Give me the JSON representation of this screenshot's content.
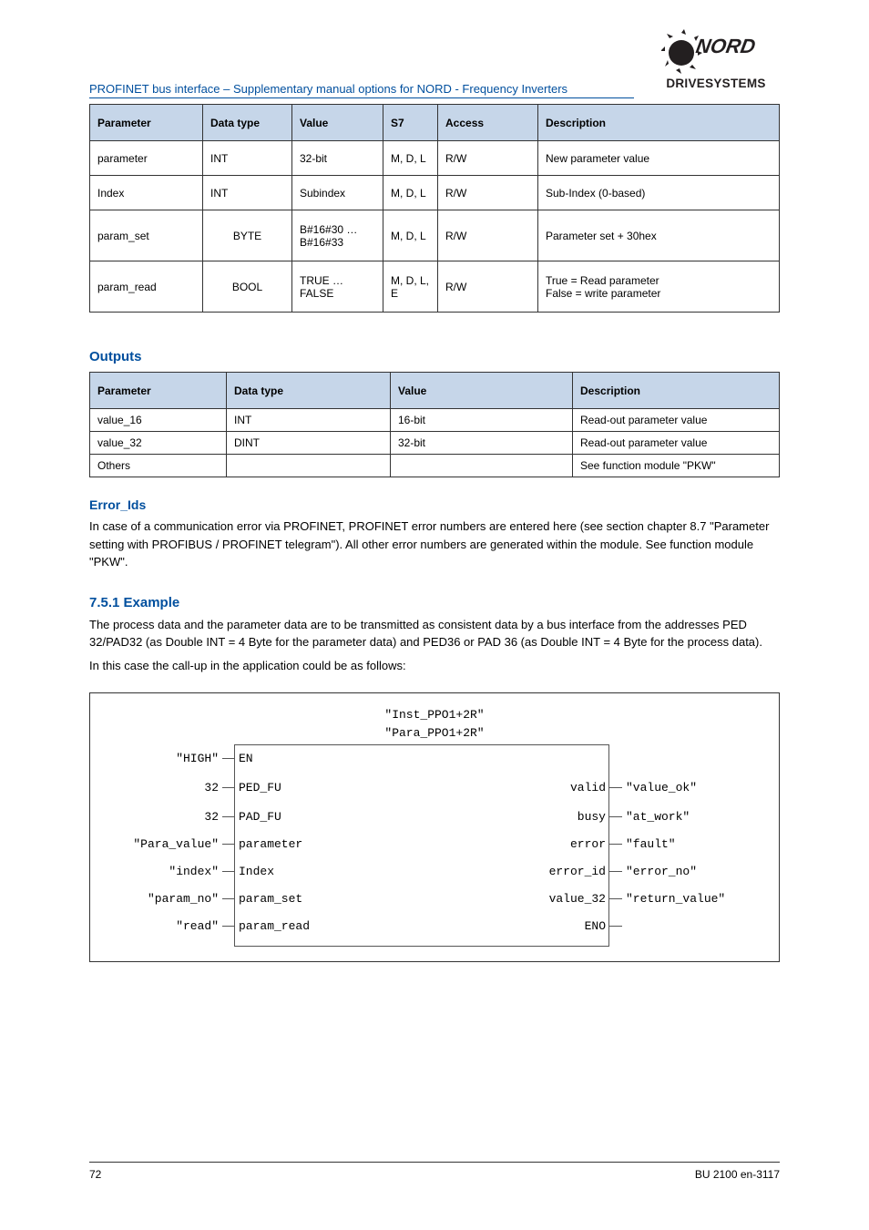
{
  "header": {
    "title": "PROFINET bus interface – Supplementary manual options for NORD - Frequency Inverters"
  },
  "logo": {
    "brand": "NORD",
    "sub": "DRIVESYSTEMS"
  },
  "table1": {
    "headers": [
      "Parameter",
      "Data type",
      "Value",
      "S7",
      "Access",
      "Description"
    ],
    "rows": [
      {
        "c0": "parameter",
        "c1": "INT",
        "c2": "32-bit",
        "c3": "M, D, L",
        "c4": "R/W",
        "c5": "New parameter value"
      },
      {
        "c0": "Index",
        "c1": "INT",
        "c2": "Subindex",
        "c3": "M, D, L",
        "c4": "R/W",
        "c5": "Sub-Index (0-based)"
      },
      {
        "c0": "param_set",
        "c1": "BYTE",
        "c2": "B#16#30 … B#16#33",
        "c3": "M, D, L",
        "c4": "R/W",
        "c5": "Parameter set + 30hex"
      },
      {
        "c0": "param_read",
        "c1": "BOOL",
        "c2": "TRUE … FALSE",
        "c3": "M, D, L, E",
        "c4": "R/W",
        "c5": "True = Read parameter\nFalse = write parameter"
      }
    ]
  },
  "outputs_heading": "Outputs",
  "table2": {
    "headers": [
      "Parameter",
      "Data type",
      "Value",
      "Description"
    ],
    "rows": [
      {
        "c0": "value_16",
        "c1": "INT",
        "c2": "16-bit",
        "c3": "Read-out parameter value"
      },
      {
        "c0": "value_32",
        "c1": "DINT",
        "c2": "32-bit",
        "c3": "Read-out parameter value"
      },
      {
        "c0": "Others",
        "c1": "",
        "c2": "",
        "c3": "See function module \"PKW\""
      }
    ]
  },
  "error_ids_heading": "Error_Ids",
  "error_ids_body": "In case of a communication error via PROFINET, PROFINET error numbers are entered here (see section chapter 8.7 \"Parameter setting with PROFIBUS / PROFINET telegram\"). All other error numbers are generated within the module. See function module \"PKW\".",
  "example_heading": "7.5.1 Example",
  "example_body1": "The process data and the parameter data are to be transmitted as consistent data by a bus interface from the addresses PED 32/PAD32 (as Double INT = 4 Byte for the parameter data) and PED36 or PAD 36 (as Double INT = 4 Byte for the process data).",
  "example_body2": "In this case the call-up in the application could be as follows:",
  "fbd": {
    "inst": "\"Inst_PPO1+2R\"",
    "para": "\"Para_PPO1+2R\"",
    "left": [
      {
        "label": "\"HIGH\"",
        "name": "EN"
      },
      {
        "label": "32",
        "name": "PED_FU"
      },
      {
        "label": "32",
        "name": "PAD_FU"
      },
      {
        "label": "\"Para_value\"",
        "name": "parameter"
      },
      {
        "label": "\"index\"",
        "name": "Index"
      },
      {
        "label": "\"param_no\"",
        "name": "param_set"
      },
      {
        "label": "\"read\"",
        "name": "param_read"
      }
    ],
    "right": [
      {
        "name": "valid",
        "label": "\"value_ok\""
      },
      {
        "name": "busy",
        "label": "\"at_work\""
      },
      {
        "name": "error",
        "label": "\"fault\""
      },
      {
        "name": "error_id",
        "label": "\"error_no\""
      },
      {
        "name": "value_32",
        "label": "\"return_value\""
      },
      {
        "name": "ENO",
        "label": ""
      }
    ]
  },
  "footer": {
    "page": "72",
    "doc": "BU 2100 en-3117"
  }
}
